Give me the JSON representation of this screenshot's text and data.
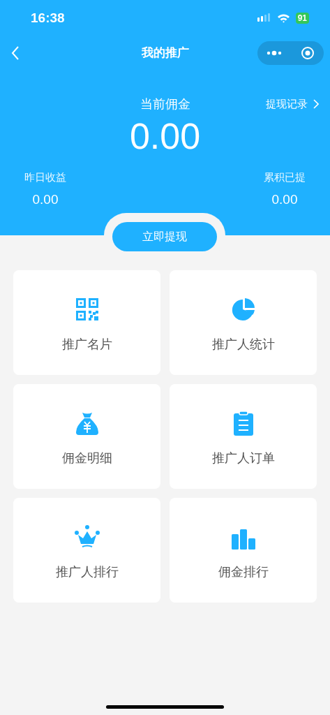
{
  "status_bar": {
    "time": "16:38",
    "battery": "91"
  },
  "nav": {
    "title": "我的推广"
  },
  "summary": {
    "label": "当前佣金",
    "amount": "0.00",
    "record_link": "提现记录",
    "stats": [
      {
        "label": "昨日收益",
        "value": "0.00"
      },
      {
        "label": "累积已提",
        "value": "0.00"
      }
    ]
  },
  "withdraw_button": "立即提现",
  "tiles": [
    {
      "kind": "qr",
      "label": "推广名片"
    },
    {
      "kind": "pie",
      "label": "推广人统计"
    },
    {
      "kind": "moneybag",
      "label": "佣金明细"
    },
    {
      "kind": "clipboard",
      "label": "推广人订单"
    },
    {
      "kind": "crown",
      "label": "推广人排行"
    },
    {
      "kind": "podium",
      "label": "佣金排行"
    }
  ]
}
